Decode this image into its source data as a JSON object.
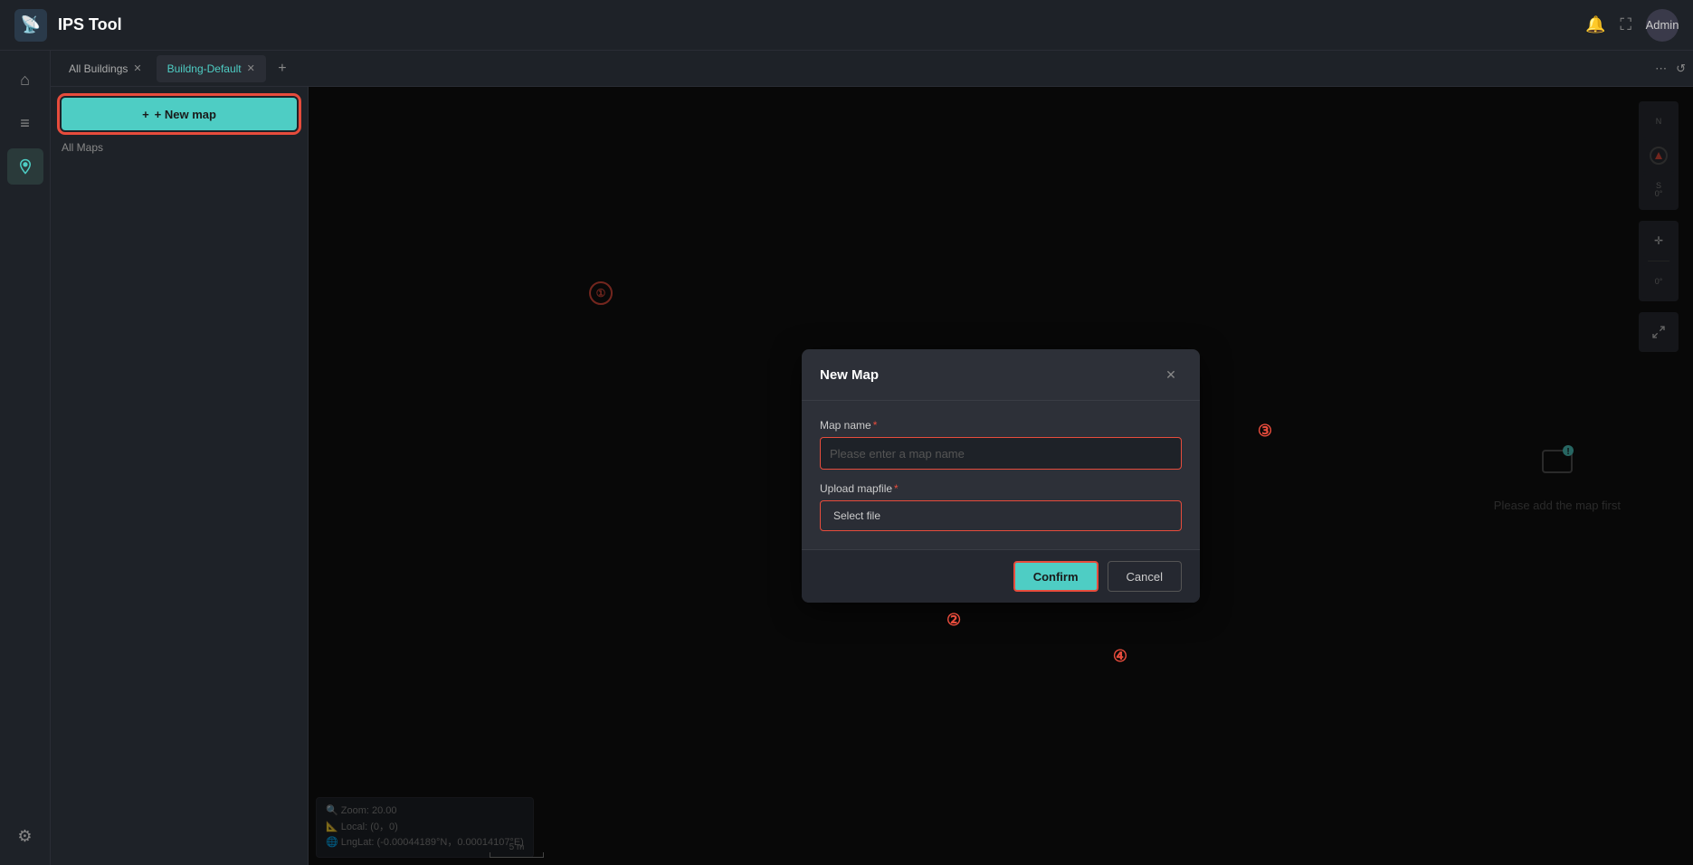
{
  "app": {
    "title": "IPS Tool",
    "logo_icon": "📡",
    "admin_label": "Admin"
  },
  "header": {
    "bell_icon": "🔔",
    "fullscreen_icon": "⛶",
    "refresh_icon": "↺",
    "more_icon": "⋯"
  },
  "sidebar": {
    "items": [
      {
        "id": "home",
        "icon": "⌂",
        "active": false
      },
      {
        "id": "list",
        "icon": "☰",
        "active": false
      },
      {
        "id": "map",
        "icon": "📍",
        "active": true
      }
    ],
    "bottom": [
      {
        "id": "settings",
        "icon": "⚙",
        "active": false
      }
    ]
  },
  "tabs": [
    {
      "id": "all-buildings",
      "label": "All Buildings",
      "closeable": true,
      "active": false
    },
    {
      "id": "building-default",
      "label": "Buildng-Default",
      "closeable": true,
      "active": true
    }
  ],
  "tab_add_icon": "+",
  "left_panel": {
    "new_map_btn": "+ New map",
    "all_maps_label": "All Maps"
  },
  "map": {
    "please_add_text": "Please add the map first",
    "controls": {
      "north_label": "N",
      "compass_icon": "↑",
      "south_label": "S",
      "degrees1": "0°",
      "move_icon": "✛",
      "degrees2": "0°",
      "fullscreen_icon": "⛶"
    },
    "bottom_bar": {
      "zoom_label": "Zoom:",
      "zoom_value": "20.00",
      "local_label": "Local:",
      "local_value": "(0，0)",
      "lnglat_label": "LngLat:",
      "lnglat_value": "(-0.00044189°N，0.00014107°E)"
    },
    "scale_label": "5 m"
  },
  "modal": {
    "title": "New Map",
    "close_icon": "✕",
    "map_name_label": "Map name",
    "map_name_placeholder": "Please enter a map name",
    "upload_label": "Upload mapfile",
    "select_file_btn": "Select file",
    "confirm_btn": "Confirm",
    "cancel_btn": "Cancel"
  },
  "annotations": [
    {
      "id": "1",
      "num": "①"
    },
    {
      "id": "2",
      "num": "②"
    },
    {
      "id": "3",
      "num": "③"
    },
    {
      "id": "4",
      "num": "④"
    }
  ]
}
